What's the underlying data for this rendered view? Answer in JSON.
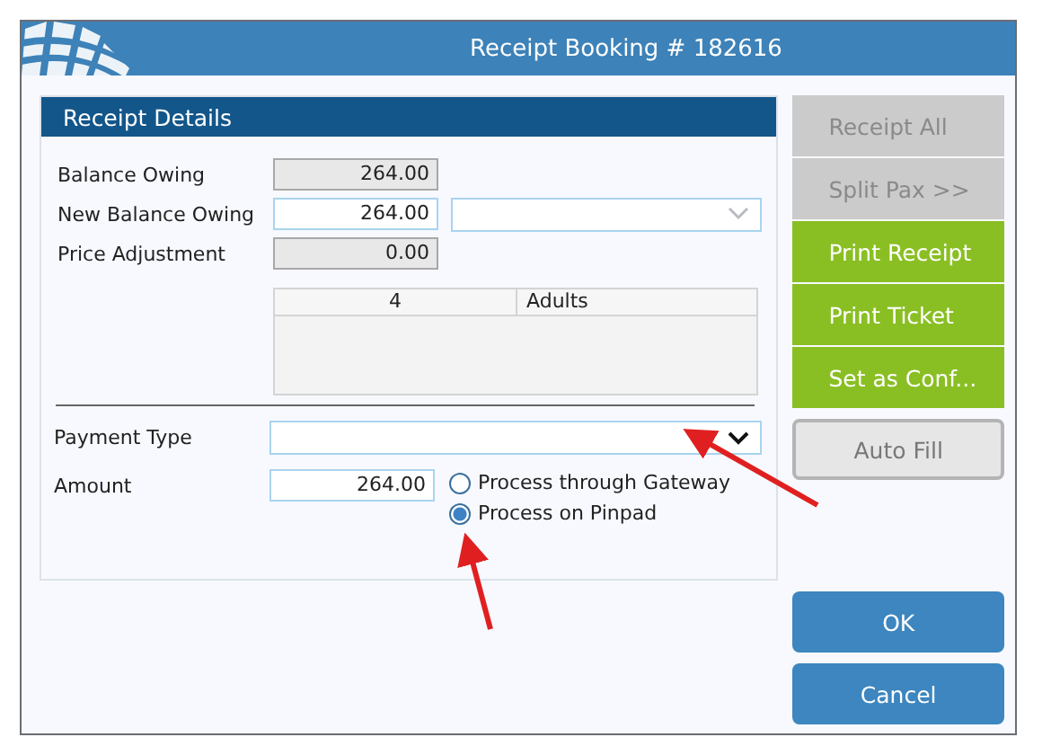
{
  "window": {
    "title": "Receipt Booking # 182616"
  },
  "panel": {
    "title": "Receipt Details"
  },
  "fields": [
    {
      "label": "Balance Owing",
      "value": "264.00",
      "disabled": true
    },
    {
      "label": "New Balance Owing",
      "value": "264.00",
      "disabled": false
    },
    {
      "label": "Price Adjustment",
      "value": "0.00",
      "disabled": true
    }
  ],
  "pax_grid": {
    "rows": [
      {
        "count": "4",
        "type": "Adults"
      }
    ]
  },
  "payment": {
    "label": "Payment Type",
    "amount_label": "Amount",
    "amount": "264.00"
  },
  "process_options": [
    {
      "label": "Process through Gateway",
      "selected": false
    },
    {
      "label": "Process on Pinpad",
      "selected": true
    }
  ],
  "side_buttons": [
    {
      "label": "Receipt All",
      "kind": "disabled"
    },
    {
      "label": "Split Pax >>",
      "kind": "disabled"
    },
    {
      "label": "Print Receipt",
      "kind": "action"
    },
    {
      "label": "Print Ticket",
      "kind": "action"
    },
    {
      "label": "Set as Conf...",
      "kind": "action"
    },
    {
      "label": "Auto Fill",
      "kind": "outline"
    }
  ],
  "dialog_buttons": [
    "OK",
    "Cancel"
  ]
}
